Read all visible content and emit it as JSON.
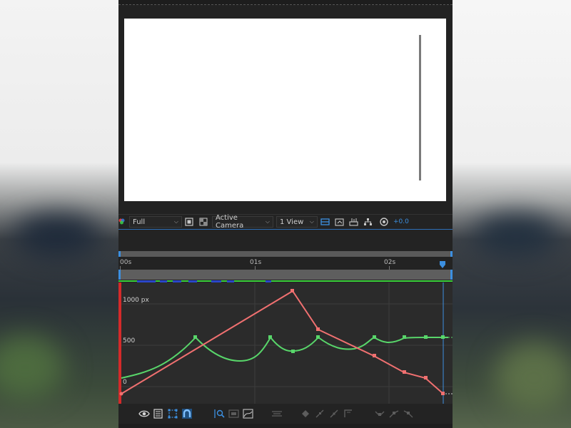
{
  "viewer": {
    "resolution": "Full",
    "view_camera": "Active Camera",
    "view_layout": "1 View",
    "exposure": "+0.0"
  },
  "timeline": {
    "ruler_labels": [
      "00s",
      "01s",
      "02s"
    ]
  },
  "graph": {
    "value_labels": [
      "1000 px",
      "500",
      "0"
    ]
  },
  "colors": {
    "panel_bg": "#232323",
    "graph_bg": "#2b2b2b",
    "accent_blue": "#3c8fe0",
    "curve_red": "#f07070",
    "curve_green": "#58d66a",
    "work_area_line": "#3ad13a",
    "playhead_red": "#d42a2a"
  },
  "icons": {
    "viewer_bar": [
      "color-management-icon",
      "region-of-interest-icon",
      "transparency-grid-icon",
      "fast-previews-icon",
      "snapshot-icon",
      "show-channel-icon",
      "flowchart-icon",
      "reset-exposure-icon"
    ],
    "bottom_bar": [
      "eye-icon",
      "list-icon",
      "transform-box-icon",
      "snap-icon",
      "fit-selection-icon",
      "fit-all-icon",
      "graph-type-icon",
      "separate-dimensions-icon",
      "keyframe-icon",
      "hold-icon",
      "linear-icon",
      "auto-bezier-icon",
      "easy-ease-icon",
      "easy-ease-in-icon",
      "easy-ease-out-icon"
    ]
  }
}
